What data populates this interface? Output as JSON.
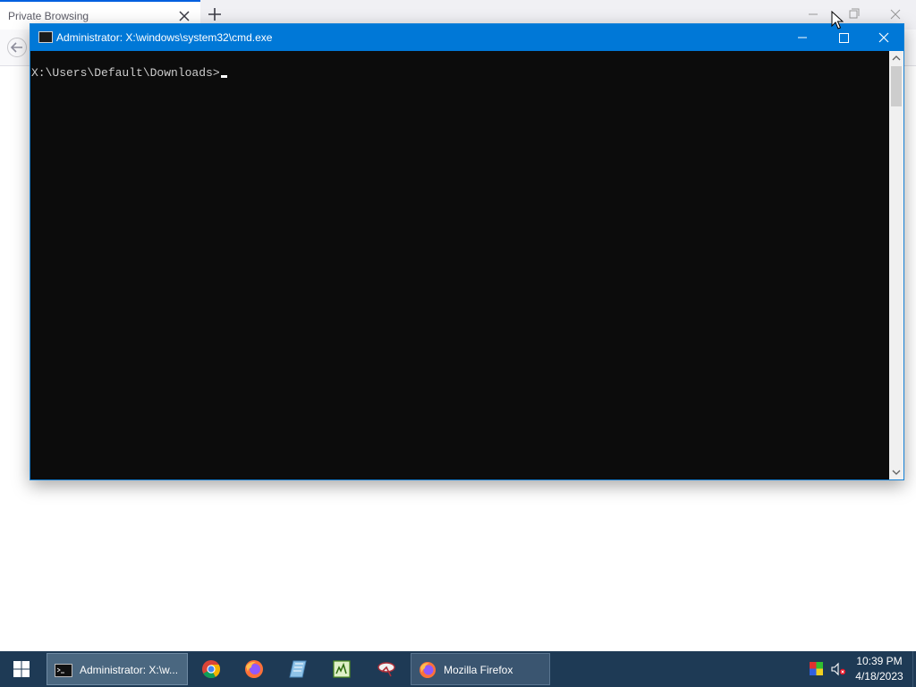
{
  "browser": {
    "tab_title": "Private Browsing"
  },
  "cmd": {
    "title": "Administrator: X:\\windows\\system32\\cmd.exe",
    "prompt": "X:\\Users\\Default\\Downloads>",
    "background": "#0c0c0c",
    "titlebar_color": "#0078d7"
  },
  "taskbar": {
    "start_icon": "windows-logo-icon",
    "open_windows": [
      {
        "label": "Administrator: X:\\w...",
        "icon": "cmd-icon",
        "active": true
      },
      {
        "label": "Mozilla Firefox",
        "icon": "firefox-icon",
        "active": false
      }
    ],
    "pinned": [
      "chrome-icon",
      "firefox-icon",
      "app-icon",
      "notepad-icon",
      "app-icon"
    ],
    "time": "10:39 PM",
    "date": "4/18/2023"
  }
}
